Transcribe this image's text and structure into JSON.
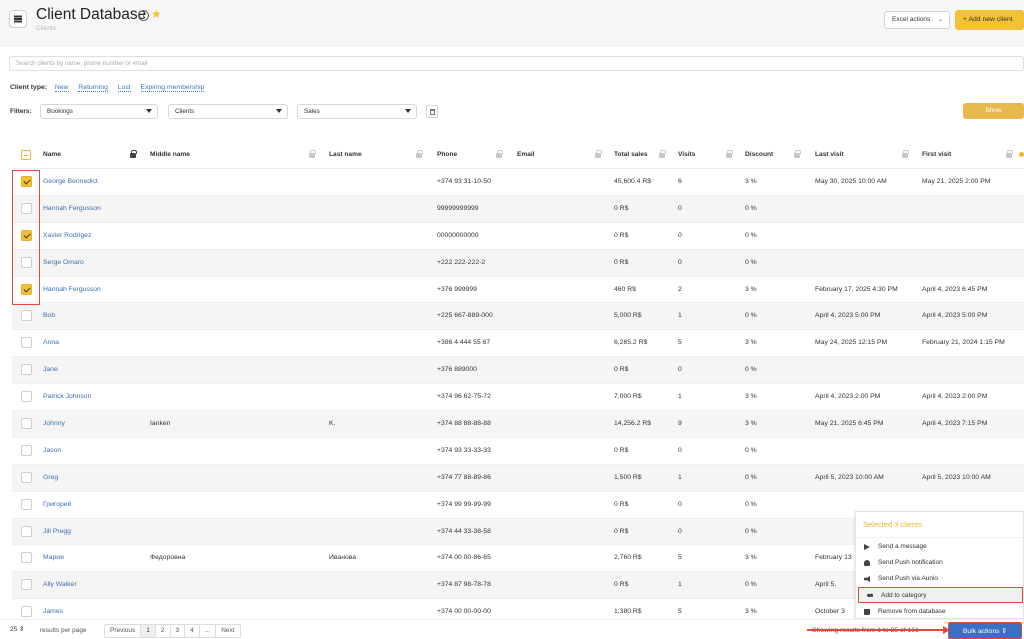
{
  "header": {
    "title": "Client Database",
    "subtitle": "Clients",
    "excel_label": "Excel actions",
    "add_label": "+ Add new client"
  },
  "search": {
    "placeholder": "Search clients by name, phone number or email"
  },
  "client_type": {
    "label": "Client type:",
    "options": [
      "New",
      "Returning",
      "Lost",
      "Expiring membership"
    ]
  },
  "filters": {
    "label": "Filters:",
    "selects": [
      "Bookings",
      "Clients",
      "Sales"
    ],
    "show_label": "Show"
  },
  "table": {
    "columns": [
      "Name",
      "Middle name",
      "Last name",
      "Phone",
      "Email",
      "Total sales",
      "Visits",
      "Discount",
      "Last visit",
      "First visit"
    ],
    "rows": [
      {
        "checked": true,
        "name": "George Bennedict",
        "middle": "",
        "last": "",
        "phone": "+374 93 31-10-50",
        "email": "",
        "sales": "45,600.4 R$",
        "visits": "6",
        "discount": "3 %",
        "last_visit": "May 30, 2025 10:00 AM",
        "first_visit": "May 21, 2025 2:00 PM"
      },
      {
        "checked": false,
        "name": "Hannah Fergusson",
        "middle": "",
        "last": "",
        "phone": "99999999999",
        "email": "",
        "sales": "0 R$",
        "visits": "0",
        "discount": "0 %",
        "last_visit": "",
        "first_visit": ""
      },
      {
        "checked": true,
        "name": "Xavier Rodrigez",
        "middle": "",
        "last": "",
        "phone": "00000000000",
        "email": "",
        "sales": "0 R$",
        "visits": "0",
        "discount": "0 %",
        "last_visit": "",
        "first_visit": ""
      },
      {
        "checked": false,
        "name": "Serge Omaro",
        "middle": "",
        "last": "",
        "phone": "+222 222-222-2",
        "email": "",
        "sales": "0 R$",
        "visits": "0",
        "discount": "0 %",
        "last_visit": "",
        "first_visit": ""
      },
      {
        "checked": true,
        "name": "Hannah Fergusson",
        "middle": "",
        "last": "",
        "phone": "+376 999999",
        "email": "",
        "sales": "460 R$",
        "visits": "2",
        "discount": "3 %",
        "last_visit": "February 17, 2025 4:30 PM",
        "first_visit": "April 4, 2023 6:45 PM"
      },
      {
        "checked": false,
        "name": "Bob",
        "middle": "",
        "last": "",
        "phone": "+225 667-889-000",
        "email": "",
        "sales": "5,000 R$",
        "visits": "1",
        "discount": "0 %",
        "last_visit": "April 4, 2023 5:00 PM",
        "first_visit": "April 4, 2023 5:00 PM"
      },
      {
        "checked": false,
        "name": "Anna",
        "middle": "",
        "last": "",
        "phone": "+386 4 444 55 67",
        "email": "",
        "sales": "6,265.2 R$",
        "visits": "5",
        "discount": "3 %",
        "last_visit": "May 24, 2025 12:15 PM",
        "first_visit": "February 21, 2024 1:15 PM"
      },
      {
        "checked": false,
        "name": "Jane",
        "middle": "",
        "last": "",
        "phone": "+376 889000",
        "email": "",
        "sales": "0 R$",
        "visits": "0",
        "discount": "0 %",
        "last_visit": "",
        "first_visit": ""
      },
      {
        "checked": false,
        "name": "Patrick Johnson",
        "middle": "",
        "last": "",
        "phone": "+374 96 62-75-72",
        "email": "",
        "sales": "7,000 R$",
        "visits": "1",
        "discount": "3 %",
        "last_visit": "April 4, 2023 2:00 PM",
        "first_visit": "April 4, 2023 2:00 PM"
      },
      {
        "checked": false,
        "name": "Johnny",
        "middle": "Ianken",
        "last": "K.",
        "phone": "+374 88 88-88-88",
        "email": "",
        "sales": "14,256.2 R$",
        "visits": "9",
        "discount": "3 %",
        "last_visit": "May 21, 2025 6:45 PM",
        "first_visit": "April 4, 2023 7:15 PM"
      },
      {
        "checked": false,
        "name": "Jason",
        "middle": "",
        "last": "",
        "phone": "+374 93 33-33-33",
        "email": "",
        "sales": "0 R$",
        "visits": "0",
        "discount": "0 %",
        "last_visit": "",
        "first_visit": ""
      },
      {
        "checked": false,
        "name": "Greg",
        "middle": "",
        "last": "",
        "phone": "+374 77 88-89-86",
        "email": "",
        "sales": "1,500 R$",
        "visits": "1",
        "discount": "0 %",
        "last_visit": "April 5, 2023 10:00 AM",
        "first_visit": "April 5, 2023 10:00 AM"
      },
      {
        "checked": false,
        "name": "Григорий",
        "middle": "",
        "last": "",
        "phone": "+374 99 99-99-99",
        "email": "",
        "sales": "0 R$",
        "visits": "0",
        "discount": "0 %",
        "last_visit": "",
        "first_visit": ""
      },
      {
        "checked": false,
        "name": "Jill Pregg",
        "middle": "",
        "last": "",
        "phone": "+374 44 33-38-58",
        "email": "",
        "sales": "0 R$",
        "visits": "0",
        "discount": "0 %",
        "last_visit": "",
        "first_visit": ""
      },
      {
        "checked": false,
        "name": "Мария",
        "middle": "Федоровна",
        "last": "Иванова",
        "phone": "+374 00 00-86-65",
        "email": "",
        "sales": "2,760 R$",
        "visits": "5",
        "discount": "3 %",
        "last_visit": "February 13",
        "first_visit": ""
      },
      {
        "checked": false,
        "name": "Ally Walker",
        "middle": "",
        "last": "",
        "phone": "+374 87 98-78-78",
        "email": "",
        "sales": "0 R$",
        "visits": "1",
        "discount": "0 %",
        "last_visit": "April 5,",
        "first_visit": ""
      },
      {
        "checked": false,
        "name": "James",
        "middle": "",
        "last": "",
        "phone": "+374 00 00-00-00",
        "email": "",
        "sales": "1,380 R$",
        "visits": "5",
        "discount": "3 %",
        "last_visit": "October 3",
        "first_visit": ""
      }
    ]
  },
  "popup": {
    "title": "Selected 3 clients",
    "items": [
      "Send a message",
      "Send Push notification",
      "Send Push via Aunio",
      "Add to category",
      "Remove from database"
    ]
  },
  "footer": {
    "per_page": "25",
    "per_page_label": "results per page",
    "pages": [
      "Previous",
      "1",
      "2",
      "3",
      "4",
      "...",
      "Next"
    ],
    "showing": "Showing results from 1 to 25 of 161",
    "bulk_label": "Bulk actions"
  },
  "colors": {
    "accent": "#f3c234",
    "link": "#3a6fb0",
    "primary": "#3a6fc4",
    "highlight": "#e04a3a"
  }
}
